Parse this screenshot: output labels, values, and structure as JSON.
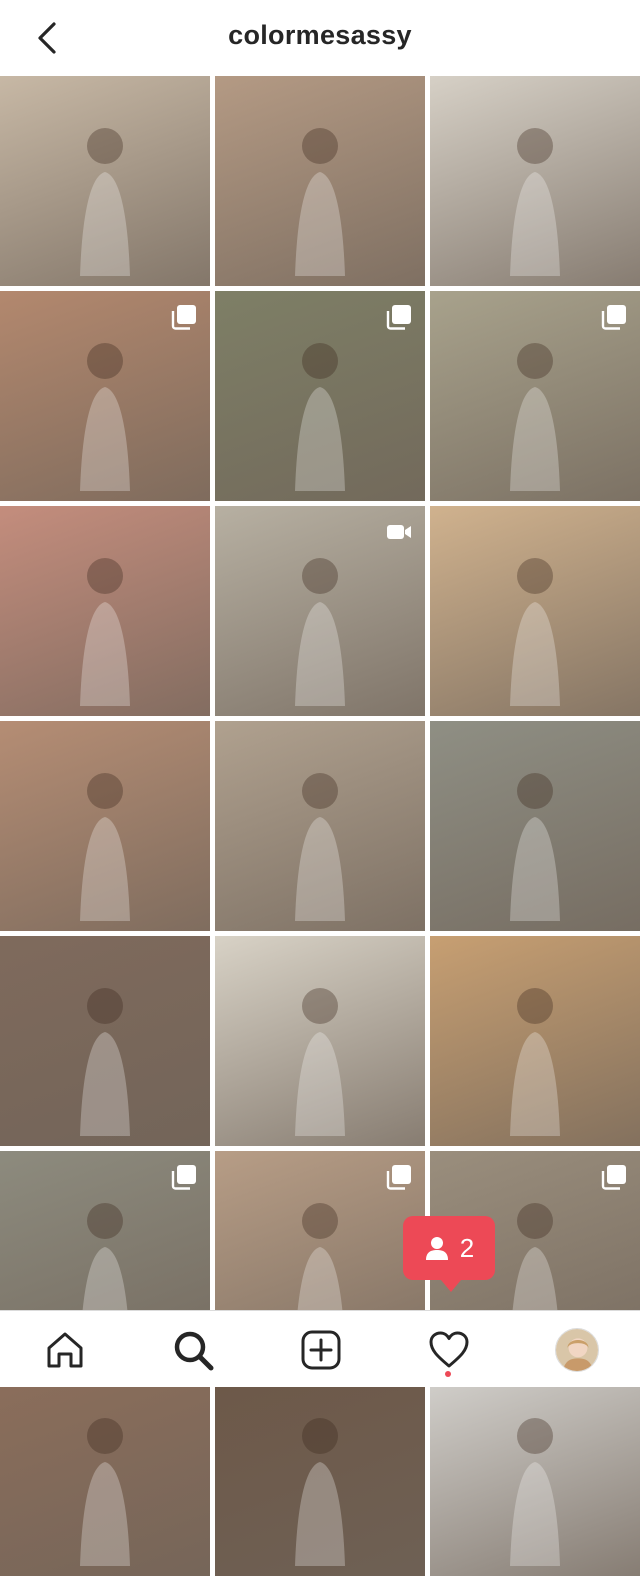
{
  "header": {
    "title": "colormesassy"
  },
  "colors": {
    "accent": "#ed4956",
    "text": "#262626"
  },
  "grid": {
    "rows": [
      [
        {
          "badge": "none",
          "bg": "#c7b8a5"
        },
        {
          "badge": "none",
          "bg": "#b49a84"
        },
        {
          "badge": "none",
          "bg": "#d6d0c6"
        }
      ],
      [
        {
          "badge": "carousel",
          "bg": "#b3886e"
        },
        {
          "badge": "carousel",
          "bg": "#7e7f66"
        },
        {
          "badge": "carousel",
          "bg": "#a8a28c"
        }
      ],
      [
        {
          "badge": "none",
          "bg": "#c48d7d"
        },
        {
          "badge": "video",
          "bg": "#b7b0a2"
        },
        {
          "badge": "none",
          "bg": "#d0b28e"
        }
      ],
      [
        {
          "badge": "none",
          "bg": "#b58d74"
        },
        {
          "badge": "none",
          "bg": "#b0a18f"
        },
        {
          "badge": "none",
          "bg": "#8f8f84"
        }
      ],
      [
        {
          "badge": "none",
          "bg": "#7f6a5c"
        },
        {
          "badge": "none",
          "bg": "#d8d2c6"
        },
        {
          "badge": "none",
          "bg": "#c79f72"
        }
      ],
      [
        {
          "badge": "carousel",
          "bg": "#8d8b7e"
        },
        {
          "badge": "carousel",
          "bg": "#b79d86"
        },
        {
          "badge": "carousel",
          "bg": "#9a8e7d"
        }
      ],
      [
        {
          "badge": "none",
          "bg": "#8c6e5b"
        },
        {
          "badge": "none",
          "bg": "#6d5848"
        },
        {
          "badge": "none",
          "bg": "#d5d3cf"
        }
      ]
    ]
  },
  "notification": {
    "icon": "person-icon",
    "count": "2"
  },
  "nav": [
    {
      "name": "home-icon"
    },
    {
      "name": "search-icon"
    },
    {
      "name": "add-post-icon"
    },
    {
      "name": "heart-icon"
    },
    {
      "name": "profile-avatar"
    }
  ]
}
